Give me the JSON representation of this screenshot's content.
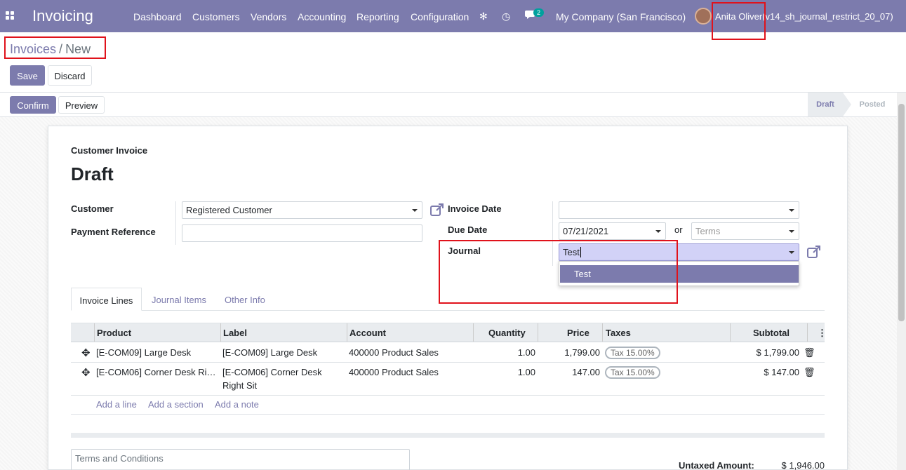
{
  "topbar": {
    "app_title": "Invoicing",
    "menu": [
      "Dashboard",
      "Customers",
      "Vendors",
      "Accounting",
      "Reporting",
      "Configuration"
    ],
    "icons": [
      "bug-icon",
      "clock-icon",
      "chat-icon"
    ],
    "messages_count": "2",
    "company": "My Company (San Francisco)",
    "user": "Anita Oliver",
    "database": "(v14_sh_journal_restrict_20_07)"
  },
  "breadcrumb": {
    "parent": "Invoices",
    "separator": "/",
    "current": "New"
  },
  "actions": {
    "save": "Save",
    "discard": "Discard",
    "confirm": "Confirm",
    "preview": "Preview"
  },
  "status": {
    "stages": [
      "Draft",
      "Posted"
    ],
    "active": "Draft"
  },
  "form": {
    "move_type": "Customer Invoice",
    "state_title": "Draft",
    "customer_label": "Customer",
    "customer_value": "Registered Customer",
    "payment_ref_label": "Payment Reference",
    "payment_ref_value": "",
    "invoice_date_label": "Invoice Date",
    "invoice_date_value": "",
    "due_date_label": "Due Date",
    "due_date_value": "07/21/2021",
    "or_text": "or",
    "terms_placeholder": "Terms",
    "journal_label": "Journal",
    "journal_value": "Test",
    "journal_dropdown_options": [
      "Test"
    ]
  },
  "tabs": [
    "Invoice Lines",
    "Journal Items",
    "Other Info"
  ],
  "lines": {
    "headers": [
      "Product",
      "Label",
      "Account",
      "Quantity",
      "Price",
      "Taxes",
      "Subtotal"
    ],
    "rows": [
      {
        "product": "[E-COM09] Large Desk",
        "label": "[E-COM09] Large Desk",
        "label2": "",
        "account": "400000 Product Sales",
        "quantity": "1.00",
        "price": "1,799.00",
        "tax": "Tax 15.00%",
        "subtotal": "$ 1,799.00"
      },
      {
        "product": "[E-COM06] Corner Desk Ri…",
        "label": "[E-COM06] Corner Desk",
        "label2": "Right Sit",
        "account": "400000 Product Sales",
        "quantity": "1.00",
        "price": "147.00",
        "tax": "Tax 15.00%",
        "subtotal": "$ 147.00"
      }
    ],
    "add_links": [
      "Add a line",
      "Add a section",
      "Add a note"
    ]
  },
  "terms_placeholder": "Terms and Conditions",
  "totals": {
    "untaxed_label": "Untaxed Amount:",
    "untaxed_value": "$ 1,946.00"
  },
  "colors": {
    "brand": "#7c7bad",
    "highlight": "#e0121b"
  }
}
